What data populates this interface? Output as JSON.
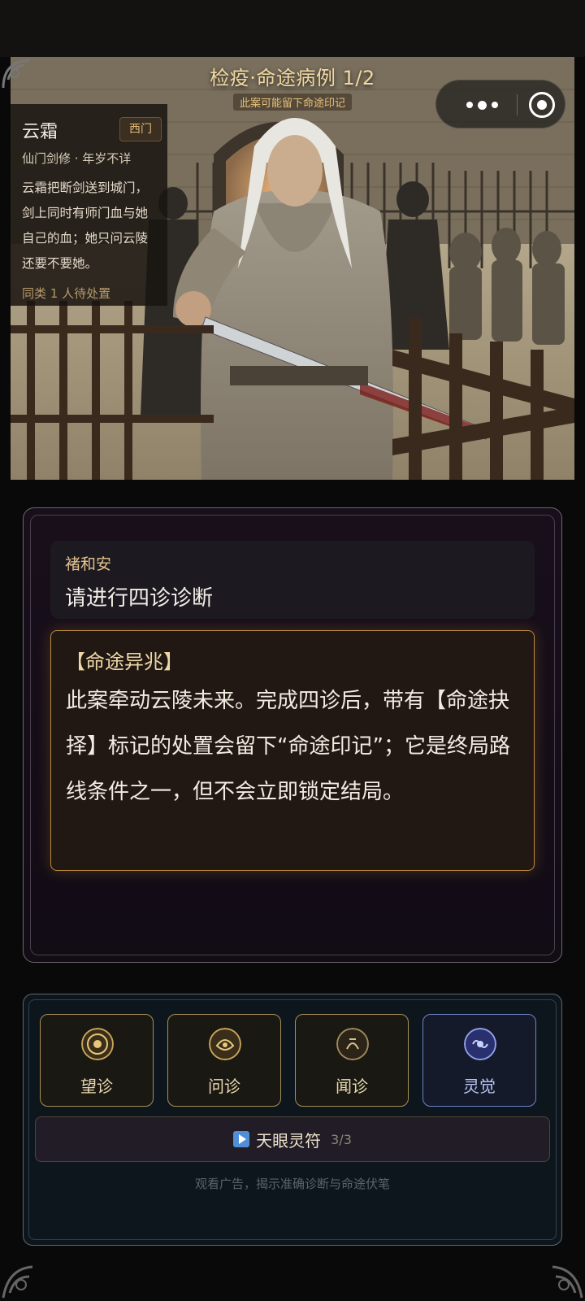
{
  "case": {
    "title": "检疫·命途病例 1/2",
    "subtitle": "此案可能留下命途印记"
  },
  "patient": {
    "name": "云霜",
    "location": "西门",
    "meta": "仙门剑修 · 年岁不详",
    "description": "云霜把断剑送到城门，剑上同时有师门血与她自己的血；她只问云陵还要不要她。",
    "queue": "同类 1 人待处置"
  },
  "dialog": {
    "speaker": "褚和安",
    "line": "请进行四诊诊断",
    "omen_title": "【命途异兆】",
    "omen_body": "此案牵动云陵未来。完成四诊后，带有【命途抉择】标记的处置会留下“命途印记”；它是终局路线条件之一，但不会立即锁定结局。"
  },
  "actions": {
    "buttons": [
      {
        "label": "望诊",
        "icon": "eye-diagnosis-emblem-icon"
      },
      {
        "label": "问诊",
        "icon": "ask-diagnosis-emblem-icon"
      },
      {
        "label": "闻诊",
        "icon": "listen-diagnosis-emblem-icon"
      },
      {
        "label": "灵觉",
        "icon": "spirit-sense-emblem-icon"
      }
    ],
    "ad_label": "天眼灵符",
    "ad_count": "3/3",
    "ad_hint": "观看广告，揭示准确诊断与命途伏笔"
  },
  "colors": {
    "gold": "#e2c48f",
    "spirit_blue": "#6b83c9",
    "panel_bg": "#180f1b"
  }
}
